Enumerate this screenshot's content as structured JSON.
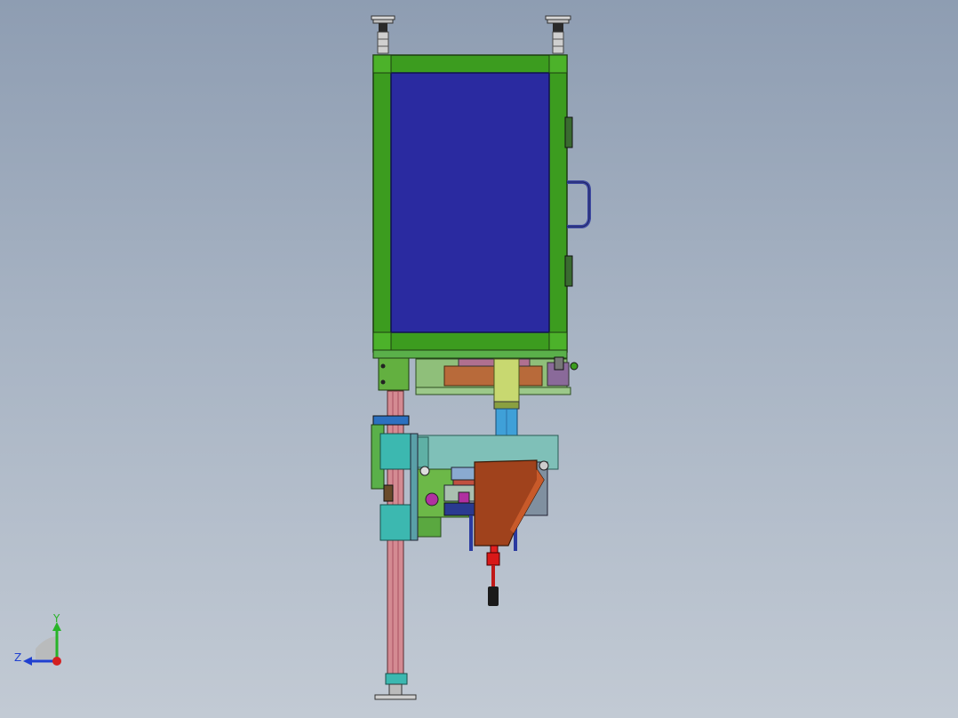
{
  "viewport": {
    "background_top": "#8e9db2",
    "background_bottom": "#c2cad4"
  },
  "model": {
    "frame_color": "#3c9c1f",
    "panel_color": "#2a2aa0",
    "column_color": "#d48a92",
    "cylinder_color": "#3fa0d8",
    "bracket_color": "#a0421c",
    "block_color": "#3cb8b0"
  },
  "triad": {
    "y_label": "Y",
    "z_label": "Z",
    "x_color": "#d42020",
    "y_color": "#28b428",
    "z_color": "#2040d0"
  }
}
